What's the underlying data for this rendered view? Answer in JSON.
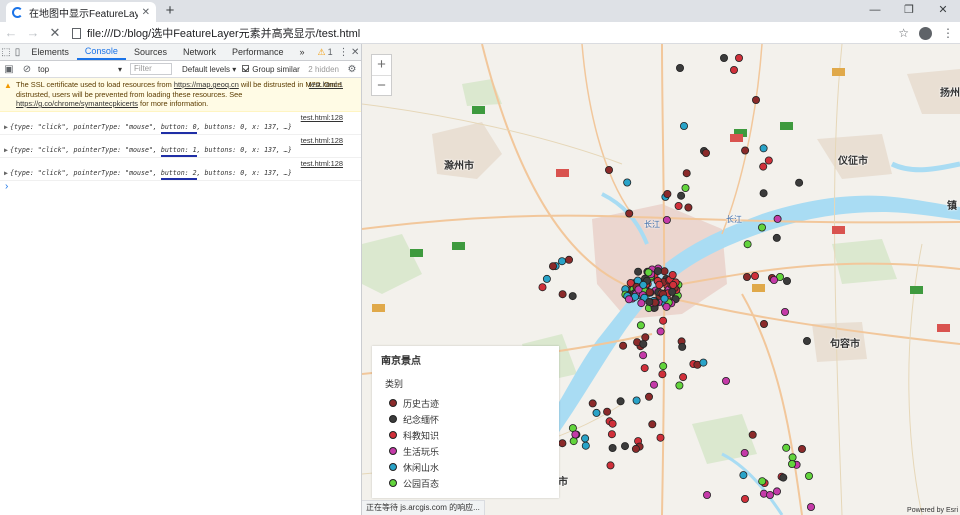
{
  "browser": {
    "tab_title": "在地图中显示FeatureLayer",
    "new_tab": "+",
    "url": "file:///D:/blog/选中FeatureLayer元素并高亮显示/test.html"
  },
  "devtools": {
    "tabs": [
      "Elements",
      "Console",
      "Sources",
      "Network",
      "Performance"
    ],
    "active_tab": "Console",
    "more": "»",
    "warning_count": "1",
    "context": "top",
    "filter_placeholder": "Filter",
    "levels": "Default levels ▾",
    "group_similar": "Group similar",
    "hidden": "2 hidden"
  },
  "console": {
    "warning": {
      "source": "test.html:1",
      "line1": "The SSL certificate used to load resources from ",
      "link1": "https://map.geoq.cn",
      "line2": " will be distrusted in M70. Once distrusted, users will be prevented from loading these resources. See ",
      "link2": "https://g.co/chrome/symantecpkicerts",
      "line3": " for more information."
    },
    "messages": [
      {
        "source": "test.html:128",
        "pre": "{type: \"click\", pointerType: \"mouse\", ",
        "hl": "button: 0",
        "post": ", buttons: 0, x: 137, …}"
      },
      {
        "source": "test.html:128",
        "pre": "{type: \"click\", pointerType: \"mouse\", ",
        "hl": "button: 1",
        "post": ", buttons: 0, x: 137, …}"
      },
      {
        "source": "test.html:128",
        "pre": "{type: \"click\", pointerType: \"mouse\", ",
        "hl": "button: 2",
        "post": ", buttons: 0, x: 137, …}"
      }
    ],
    "prompt": "›"
  },
  "map": {
    "cities": [
      "滁州市",
      "仪征市",
      "扬州",
      "句容市",
      "镇",
      "市"
    ],
    "rivers": [
      "长江",
      "长江"
    ],
    "zoom_in": "+",
    "zoom_out": "−",
    "status": "正在等待 js.arcgis.com 的响应...",
    "attribution": "Powered by Esri"
  },
  "legend": {
    "title": "南京景点",
    "subtitle": "类别",
    "items": [
      {
        "label": "历史古迹",
        "color": "#8b2a2a"
      },
      {
        "label": "纪念缅怀",
        "color": "#3b3b3b"
      },
      {
        "label": "科教知识",
        "color": "#d0303a"
      },
      {
        "label": "生活玩乐",
        "color": "#c43aa8"
      },
      {
        "label": "休闲山水",
        "color": "#29a3c8"
      },
      {
        "label": "公园百态",
        "color": "#62d43c"
      }
    ]
  }
}
